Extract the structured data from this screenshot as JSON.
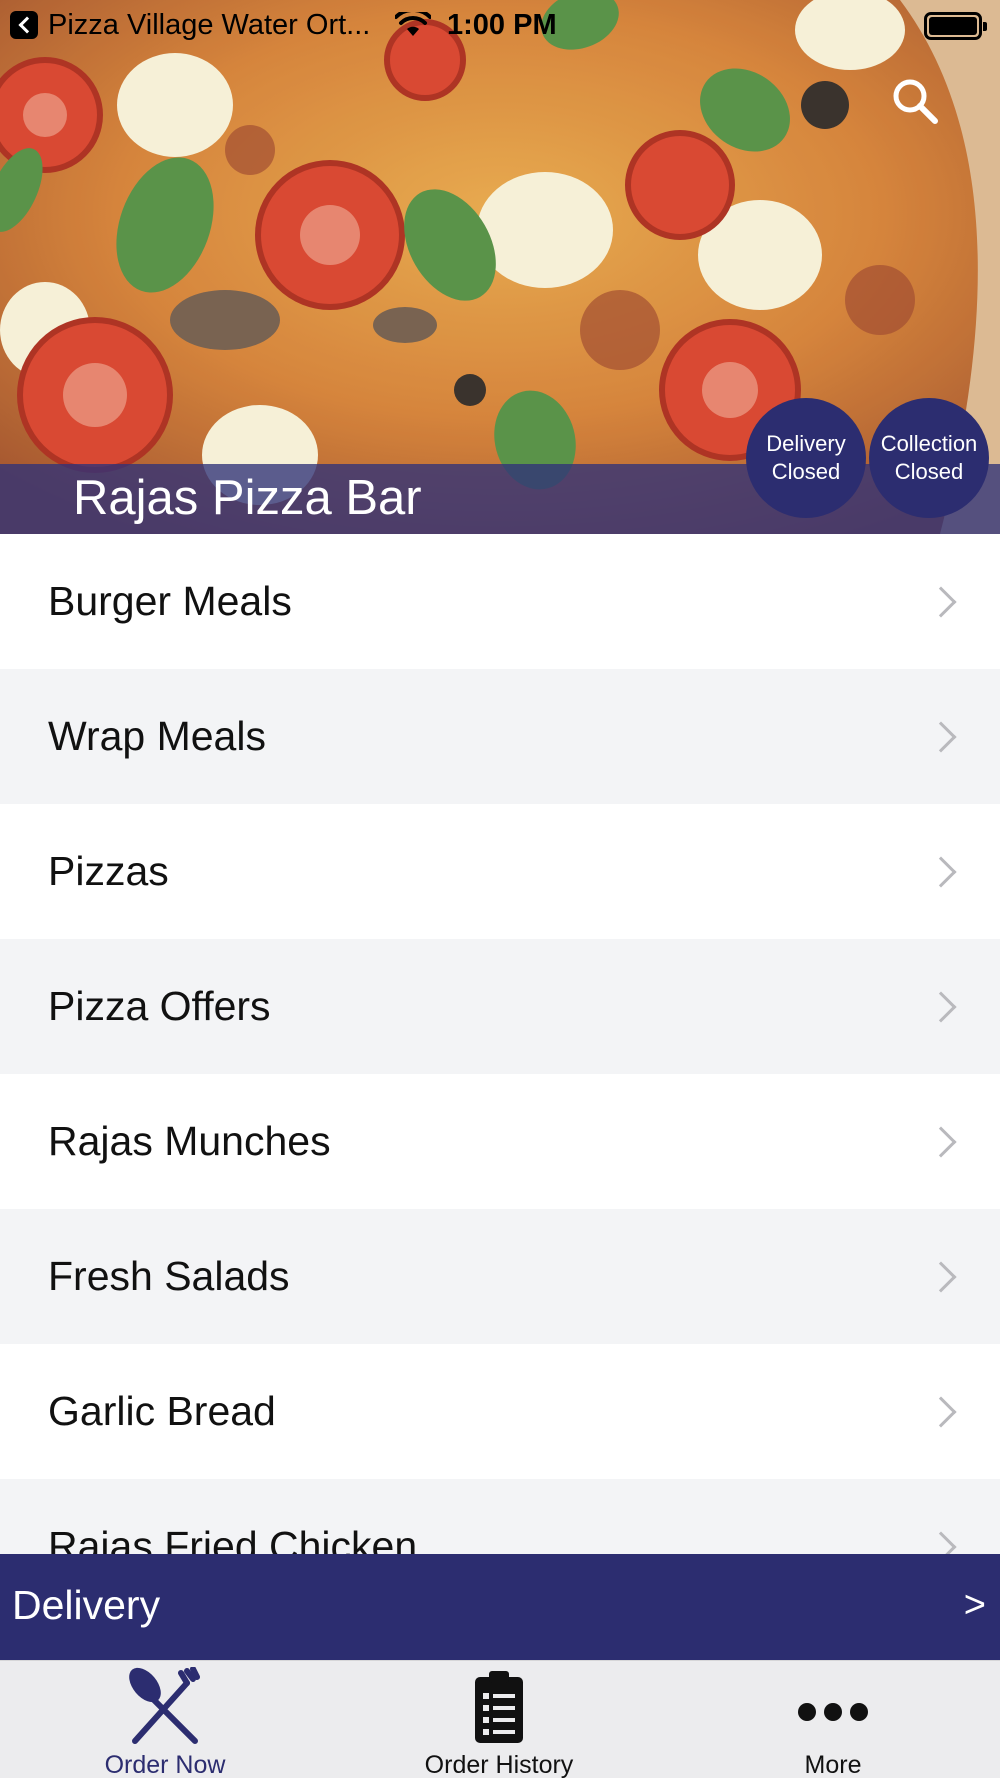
{
  "status_bar": {
    "back_app": "Pizza Village Water Ort...",
    "time": "1:00 PM"
  },
  "header": {
    "store_name": "Rajas Pizza Bar",
    "search_icon": "search-icon",
    "badges": {
      "delivery": {
        "line1": "Delivery",
        "line2": "Closed"
      },
      "collection": {
        "line1": "Collection",
        "line2": "Closed"
      }
    }
  },
  "menu": {
    "categories": [
      "Burger Meals",
      "Wrap Meals",
      "Pizzas",
      "Pizza Offers",
      "Rajas Munches",
      "Fresh Salads",
      "Garlic Bread",
      "Rajas Fried Chicken"
    ]
  },
  "order_type": {
    "label": "Delivery",
    "arrow": ">"
  },
  "tab_bar": {
    "items": [
      {
        "label": "Order Now",
        "icon": "fork-knife-icon"
      },
      {
        "label": "Order History",
        "icon": "clipboard-list-icon"
      },
      {
        "label": "More",
        "icon": "more-dots-icon"
      }
    ]
  },
  "colors": {
    "brand": "#2c2d70",
    "row_alt": "#f3f4f6",
    "tab_bar_bg": "#ececee"
  }
}
